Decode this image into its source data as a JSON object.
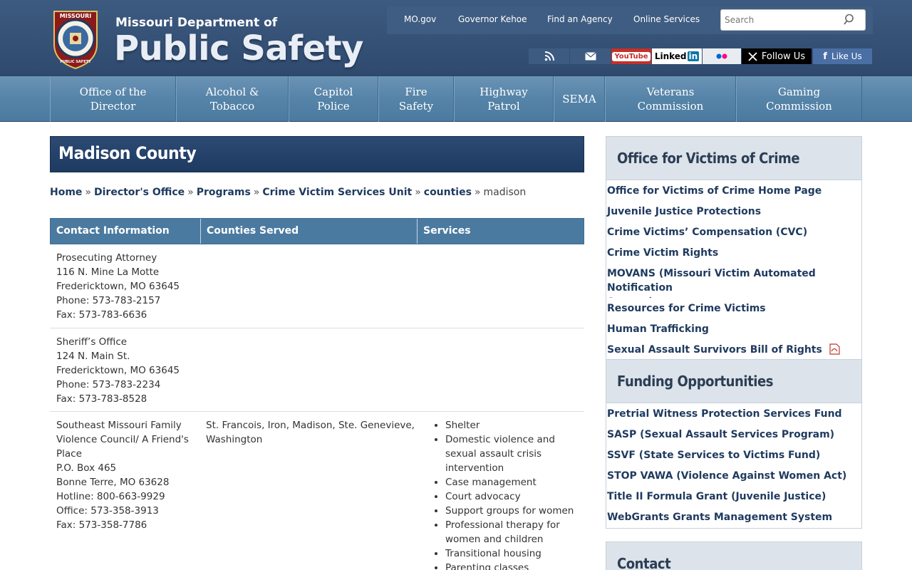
{
  "header": {
    "logo_top": "Missouri Department of",
    "logo_main": "Public Safety",
    "seal_text_top": "MISSOURI",
    "seal_text_bottom": "PUBLIC SAFETY",
    "utility_links": [
      "MO.gov",
      "Governor Kehoe",
      "Find an Agency",
      "Online Services"
    ],
    "search_placeholder": "Search",
    "social": {
      "rss": "rss-icon",
      "email": "envelope-icon",
      "youtube": "YouTube",
      "linkedin": "Linked",
      "linkedin_in": "in",
      "flickr": "flickr-icon",
      "x_follow": "Follow Us",
      "facebook_like": "Like Us"
    },
    "colors": {
      "header_bg": "#2f4a6e",
      "nav_bg": "#5785a9",
      "youtube": "#c4302b",
      "x": "#000000",
      "facebook": "#3b5998"
    }
  },
  "nav": [
    "Office of the\nDirector",
    "Alcohol &\nTobacco",
    "Capitol\nPolice",
    "Fire\nSafety",
    "Highway\nPatrol",
    "SEMA",
    "Veterans\nCommission",
    "Gaming\nCommission"
  ],
  "page": {
    "title": "Madison County",
    "breadcrumb": [
      "Home",
      "Director's Office",
      "Programs",
      "Crime Victim Services Unit",
      "counties"
    ],
    "breadcrumb_current": "madison"
  },
  "table": {
    "headers": [
      "Contact Information",
      "Counties Served",
      "Services"
    ],
    "rows": [
      {
        "contact": [
          "Prosecuting Attorney",
          "116 N. Mine La Motte",
          "Fredericktown, MO 63645",
          "Phone: 573-783-2157",
          "Fax: 573-783-6636"
        ],
        "counties": [],
        "services": []
      },
      {
        "contact": [
          "Sheriff’s Office",
          "124 N. Main St.",
          "Fredericktown, MO 63645",
          "Phone: 573-783-2234",
          "Fax: 573-783-8528"
        ],
        "counties": [],
        "services": []
      },
      {
        "contact": [
          "Southeast Missouri Family",
          "Violence Council/ A Friend's",
          "Place",
          "P.O. Box 465",
          "Bonne Terre, MO 63628",
          "Hotline: 800-663-9929",
          "Office: 573-358-3913",
          "Fax: 573-358-7786"
        ],
        "counties": [
          "St. Francois, Iron, Madison, Ste. Genevieve,",
          "Washington"
        ],
        "services": [
          "Shelter",
          "Domestic violence and\nsexual assault crisis\nintervention",
          "Case management",
          "Court advocacy",
          "Support groups for women",
          "Professional therapy for\nwomen and children",
          "Transitional housing",
          "Parenting classes"
        ]
      }
    ]
  },
  "sidebar": {
    "section1_title": "Office for Victims of Crime",
    "section1_links": [
      "Office for Victims of Crime Home Page",
      "Juvenile Justice Protections",
      "Crime Victims’ Compensation (CVC)",
      "Crime Victim Rights",
      "MOVANS (Missouri Victim Automated Notification\nSystem)",
      "Resources for Crime Victims",
      "Human Trafficking",
      "Sexual Assault Survivors Bill of Rights"
    ],
    "section2_title": "Funding Opportunities",
    "section2_links": [
      "Pretrial Witness Protection Services Fund",
      "SASP (Sexual Assault Services Program)",
      "SSVF (State Services to Victims Fund)",
      "STOP VAWA (Violence Against Women Act)",
      "Title II Formula Grant (Juvenile Justice)",
      "WebGrants Grants Management System"
    ],
    "section3_title": "Contact"
  }
}
